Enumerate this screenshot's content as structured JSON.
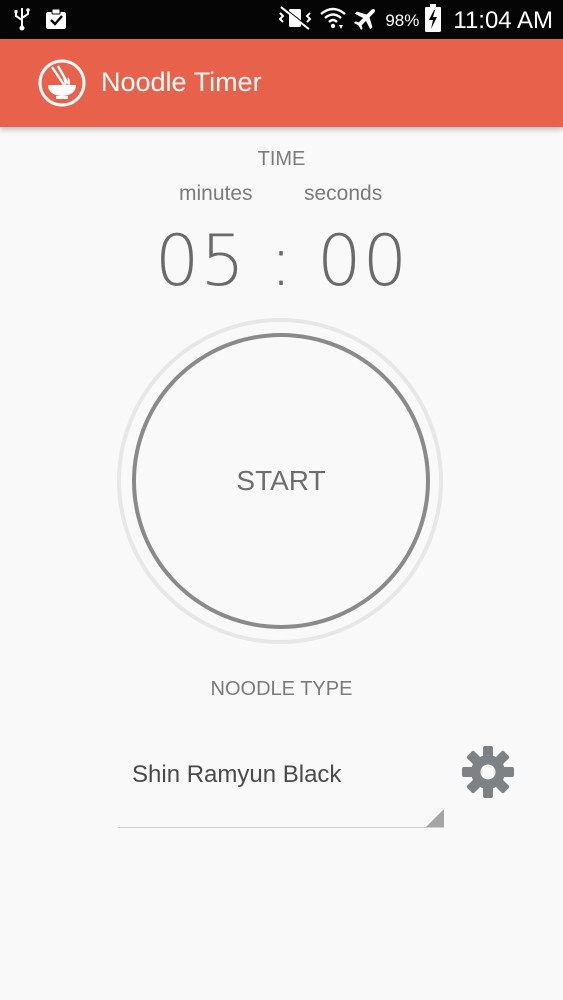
{
  "status_bar": {
    "battery_percent": "98%",
    "time": "11:04 AM",
    "icons": [
      "usb-icon",
      "clipboard-check-icon",
      "mute-vibrate-icon",
      "wifi-icon",
      "airplane-icon",
      "battery-charging-icon"
    ]
  },
  "app_bar": {
    "title": "Noodle Timer",
    "background_color": "#e8614a",
    "logo_icon": "noodle-bowl-icon"
  },
  "timer": {
    "section_label": "TIME",
    "minutes_label": "minutes",
    "seconds_label": "seconds",
    "display": "05 : 00"
  },
  "start_button": {
    "label": "START"
  },
  "noodle": {
    "section_label": "NOODLE TYPE",
    "selected": "Shin Ramyun Black",
    "settings_icon": "gear-icon"
  }
}
